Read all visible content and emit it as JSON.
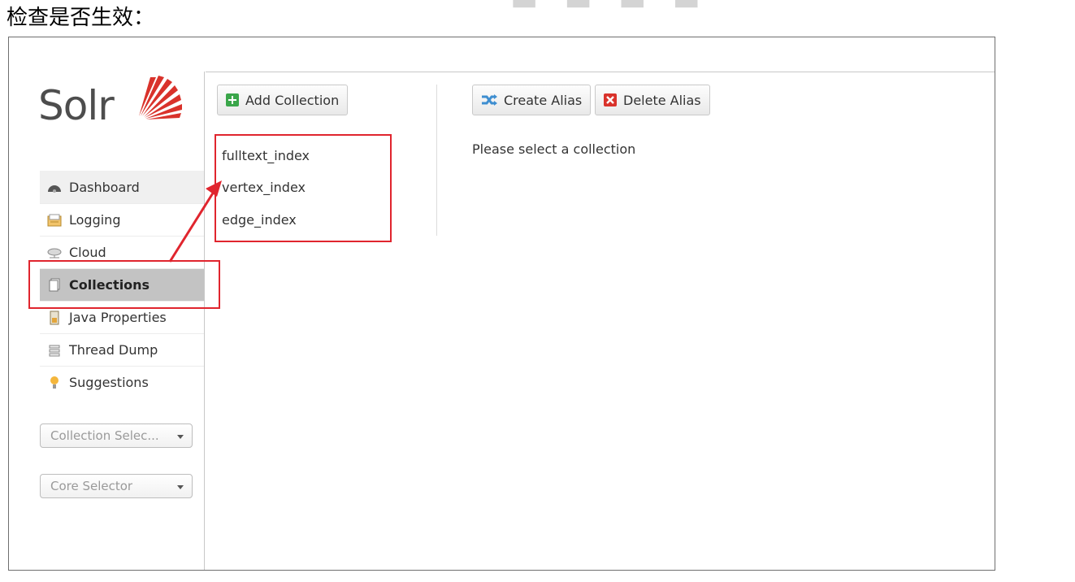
{
  "doc": {
    "heading": "检查是否生效："
  },
  "app": {
    "logo_text": "Solr"
  },
  "nav": {
    "items": [
      {
        "label": "Dashboard",
        "icon": "dashboard-icon"
      },
      {
        "label": "Logging",
        "icon": "logging-icon"
      },
      {
        "label": "Cloud",
        "icon": "cloud-icon"
      },
      {
        "label": "Collections",
        "icon": "collections-icon",
        "active": true
      },
      {
        "label": "Java Properties",
        "icon": "java-properties-icon"
      },
      {
        "label": "Thread Dump",
        "icon": "thread-dump-icon"
      },
      {
        "label": "Suggestions",
        "icon": "lightbulb-icon"
      }
    ]
  },
  "selectors": {
    "collection": "Collection Selec...",
    "core": "Core Selector"
  },
  "collections": {
    "add_label": "Add Collection",
    "items": [
      "fulltext_index",
      "vertex_index",
      "edge_index"
    ]
  },
  "alias": {
    "create_label": "Create Alias",
    "delete_label": "Delete Alias",
    "hint": "Please select a collection"
  },
  "colors": {
    "highlight": "#e0252e",
    "active_nav": "#c3c3c3",
    "logo_red": "#d9322b"
  }
}
